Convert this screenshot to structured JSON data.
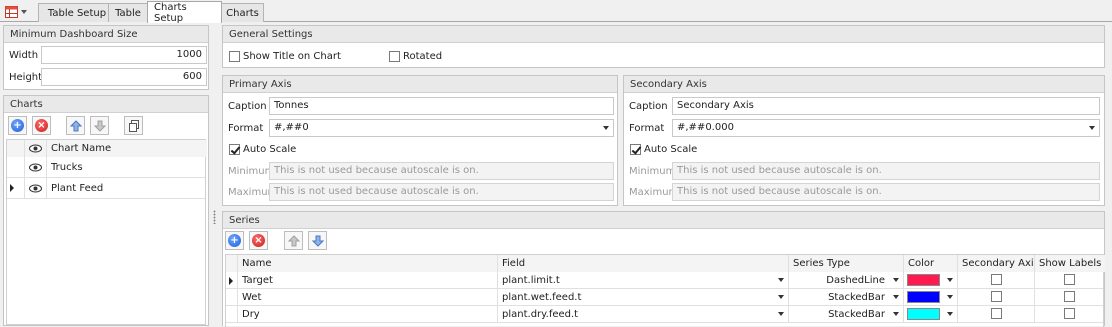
{
  "tabs": [
    {
      "label": "Table Setup",
      "active": false
    },
    {
      "label": "Table",
      "active": false
    },
    {
      "label": "Charts Setup",
      "active": true
    },
    {
      "label": "Charts",
      "active": false
    }
  ],
  "min_dashboard": {
    "title": "Minimum Dashboard Size",
    "width_label": "Width",
    "width_value": "1000",
    "height_label": "Height",
    "height_value": "600"
  },
  "charts_panel": {
    "title": "Charts",
    "column_header": "Chart Name",
    "rows": [
      "Trucks",
      "Plant Feed"
    ]
  },
  "general": {
    "title": "General Settings",
    "show_title_label": "Show Title on Chart",
    "show_title_checked": false,
    "rotated_label": "Rotated",
    "rotated_checked": false
  },
  "primary_axis": {
    "title": "Primary Axis",
    "caption_label": "Caption",
    "caption_value": "Tonnes",
    "format_label": "Format",
    "format_value": "#,##0",
    "autoscale_label": "Auto Scale",
    "autoscale_checked": true,
    "minimum_label": "Minimum",
    "minimum_placeholder": "This is not used because autoscale is on.",
    "maximum_label": "Maximum",
    "maximum_placeholder": "This is not used because autoscale is on."
  },
  "secondary_axis": {
    "title": "Secondary Axis",
    "caption_label": "Caption",
    "caption_value": "Secondary Axis",
    "format_label": "Format",
    "format_value": "#,##0.000",
    "autoscale_label": "Auto Scale",
    "autoscale_checked": true,
    "minimum_label": "Minimum",
    "minimum_placeholder": "This is not used because autoscale is on.",
    "maximum_label": "Maximum",
    "maximum_placeholder": "This is not used because autoscale is on."
  },
  "series": {
    "title": "Series",
    "headers": {
      "name": "Name",
      "field": "Field",
      "series_type": "Series Type",
      "color": "Color",
      "secondary_axis": "Secondary Axis",
      "show_labels": "Show Labels"
    },
    "rows": [
      {
        "name": "Target",
        "field": "plant.limit.t",
        "series_type": "DashedLine",
        "color": "#ff1a4f",
        "secondary_axis": false,
        "show_labels": false
      },
      {
        "name": "Wet",
        "field": "plant.wet.feed.t",
        "series_type": "StackedBar",
        "color": "#0000ff",
        "secondary_axis": false,
        "show_labels": false
      },
      {
        "name": "Dry",
        "field": "plant.dry.feed.t",
        "series_type": "StackedBar",
        "color": "#00ffff",
        "secondary_axis": false,
        "show_labels": false
      }
    ]
  }
}
